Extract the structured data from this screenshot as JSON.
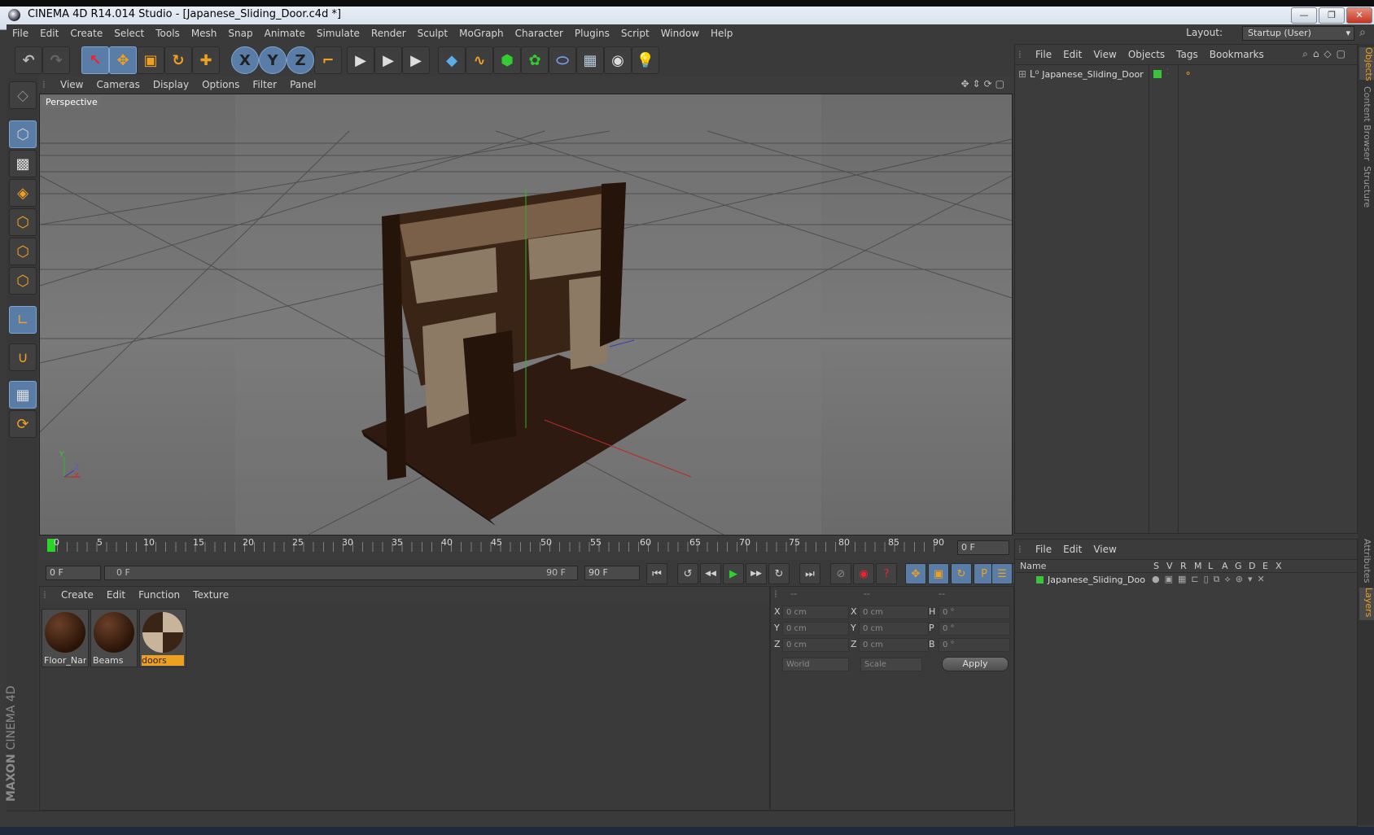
{
  "window": {
    "title": "CINEMA 4D R14.014 Studio - [Japanese_Sliding_Door.c4d *]",
    "minimize": "—",
    "maximize": "❐",
    "close": "✕"
  },
  "menubar": {
    "items": [
      "File",
      "Edit",
      "Create",
      "Select",
      "Tools",
      "Mesh",
      "Snap",
      "Animate",
      "Simulate",
      "Render",
      "Sculpt",
      "MoGraph",
      "Character",
      "Plugins",
      "Script",
      "Window",
      "Help"
    ],
    "layout_label": "Layout:",
    "layout_value": "Startup (User)"
  },
  "toolbar": {
    "undo": "↶",
    "redo": "↷",
    "tools": [
      "↖",
      "✥",
      "▣",
      "↻",
      "✚"
    ],
    "axes": [
      "X",
      "Y",
      "Z"
    ],
    "coord": "⌐",
    "render": [
      "▶",
      "▶",
      "▶"
    ],
    "create": [
      "◆",
      "∿",
      "⬢",
      "✿",
      "⬭",
      "▦",
      "◉",
      "💡"
    ]
  },
  "leftbar": {
    "icons": [
      "◇",
      "⬡",
      "▩",
      "◈",
      "⬡",
      "⬡",
      "⬡",
      "∟",
      "∪",
      "▦",
      "⟳"
    ]
  },
  "brand": {
    "maxon": "MAXON",
    "c4d": "CINEMA 4D"
  },
  "viewport": {
    "menu": [
      "View",
      "Cameras",
      "Display",
      "Options",
      "Filter",
      "Panel"
    ],
    "label": "Perspective",
    "axes": {
      "y": "Y",
      "x": "X",
      "z": "Z"
    }
  },
  "timeline": {
    "ticks": [
      "0",
      "5",
      "10",
      "15",
      "20",
      "25",
      "30",
      "35",
      "40",
      "45",
      "50",
      "55",
      "60",
      "65",
      "70",
      "75",
      "80",
      "85",
      "90"
    ],
    "current_frame": "0 F",
    "start_field": "0 F",
    "range_start": "0 F",
    "range_end": "90 F",
    "end_field": "90 F"
  },
  "transport": {
    "buttons": [
      "⏮",
      "↺",
      "◀◀",
      "▶",
      "▶▶",
      "↻",
      "⏭"
    ],
    "keys": [
      "⊘",
      "◉",
      "?",
      "✥",
      "▣",
      "↻",
      "P",
      "⁙"
    ],
    "timeline_btn": "☰"
  },
  "materials": {
    "menu": [
      "Create",
      "Edit",
      "Function",
      "Texture"
    ],
    "items": [
      {
        "name": "Floor_Narr",
        "selected": false
      },
      {
        "name": "Beams",
        "selected": false
      },
      {
        "name": "doors",
        "selected": true
      }
    ]
  },
  "coords": {
    "headers": [
      "--",
      "--",
      "--"
    ],
    "rows": [
      {
        "l1": "X",
        "v1": "0 cm",
        "l2": "X",
        "v2": "0 cm",
        "l3": "H",
        "v3": "0 °"
      },
      {
        "l1": "Y",
        "v1": "0 cm",
        "l2": "Y",
        "v2": "0 cm",
        "l3": "P",
        "v3": "0 °"
      },
      {
        "l1": "Z",
        "v1": "0 cm",
        "l2": "Z",
        "v2": "0 cm",
        "l3": "B",
        "v3": "0 °"
      }
    ],
    "mode": "World",
    "type": "Scale",
    "apply": "Apply"
  },
  "objects": {
    "menu": [
      "File",
      "Edit",
      "View",
      "Objects",
      "Tags",
      "Bookmarks"
    ],
    "items": [
      {
        "name": "Japanese_Sliding_Door"
      }
    ]
  },
  "layers": {
    "menu": [
      "File",
      "Edit",
      "View"
    ],
    "columns": [
      "Name",
      "S",
      "V",
      "R",
      "M",
      "L",
      "A",
      "G",
      "D",
      "E",
      "X"
    ],
    "rows": [
      {
        "name": "Japanese_Sliding_Doo"
      }
    ]
  },
  "right_tabs": [
    "Objects",
    "Content Browser",
    "Structure",
    "Attributes",
    "Layers"
  ],
  "colors": {
    "accent_blue": "#5a7da8",
    "layer_green": "#3ac43a",
    "selected_material": "#f0a020"
  }
}
